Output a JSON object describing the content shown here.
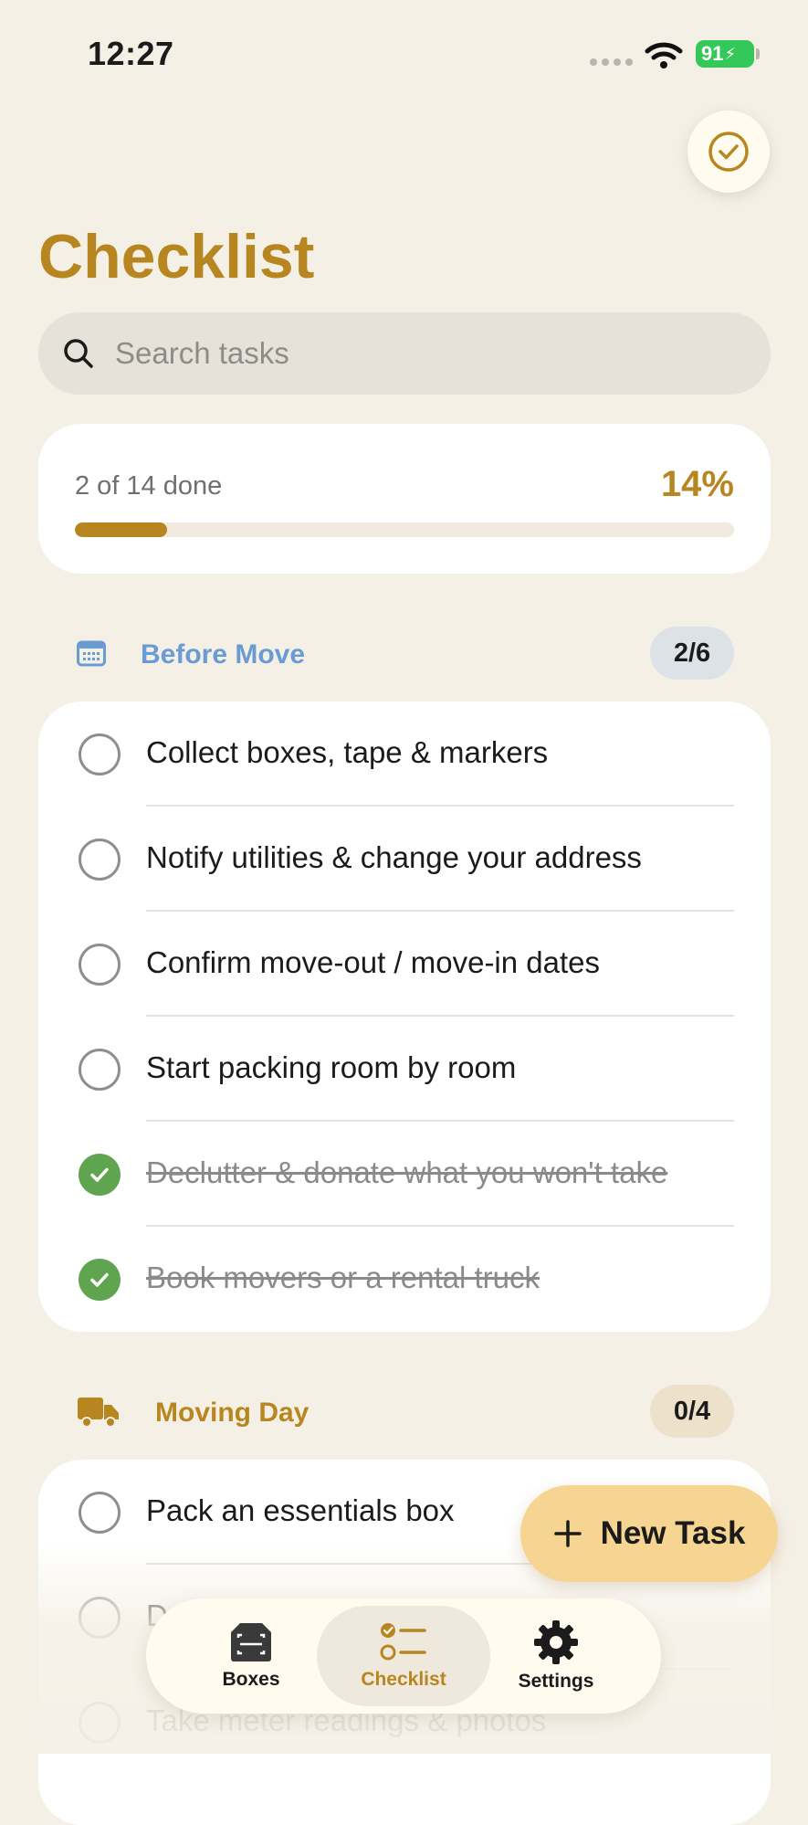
{
  "status": {
    "time": "12:27",
    "battery": "91"
  },
  "page": {
    "title": "Checklist"
  },
  "search": {
    "placeholder": "Search tasks"
  },
  "progress": {
    "summary": "2 of 14 done",
    "percent_label": "14%",
    "fraction": 0.14
  },
  "sections": [
    {
      "title": "Before Move",
      "count": "2/6",
      "color": "#6A9BD3",
      "badge_bg": "#DDE2E6",
      "icon": "calendar-icon",
      "tasks": [
        {
          "label": "Collect boxes, tape & markers",
          "done": false
        },
        {
          "label": "Notify utilities & change your address",
          "done": false
        },
        {
          "label": "Confirm move-out / move-in dates",
          "done": false
        },
        {
          "label": "Start packing room by room",
          "done": false
        },
        {
          "label": "Declutter & donate what you won't take",
          "done": true
        },
        {
          "label": "Book movers or a rental truck",
          "done": true
        }
      ]
    },
    {
      "title": "Moving Day",
      "count": "0/4",
      "color": "#B88620",
      "badge_bg": "#EDE1CB",
      "icon": "truck-icon",
      "tasks": [
        {
          "label": "Pack an essentials box",
          "done": false
        },
        {
          "label": "D",
          "done": false
        },
        {
          "label": "Take meter readings & photos",
          "done": false
        }
      ]
    }
  ],
  "fab": {
    "label": "New Task"
  },
  "tabs": [
    {
      "label": "Boxes",
      "icon": "box-scan-icon"
    },
    {
      "label": "Checklist",
      "icon": "checklist-icon",
      "active": true
    },
    {
      "label": "Settings",
      "icon": "gear-icon"
    }
  ],
  "colors": {
    "accent": "#B88620",
    "background": "#F5F0E6",
    "done_green": "#5FA44F",
    "fab": "#F6D593"
  }
}
